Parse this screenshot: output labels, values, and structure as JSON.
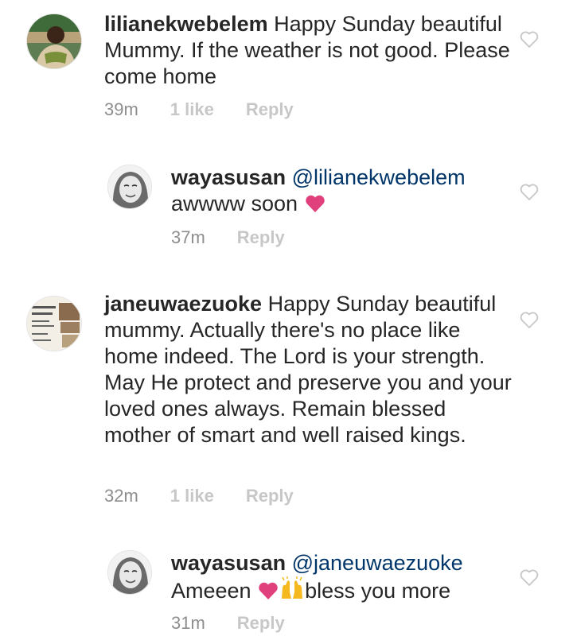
{
  "comments": [
    {
      "username": "lilianekwebelem",
      "text": "Happy Sunday beautiful Mummy. If the weather is not good. Please come home",
      "time": "39m",
      "likes": "1 like",
      "reply": "Reply"
    },
    {
      "username": "wayasusan",
      "mention": "@lilianekwebelem",
      "text": "awwww soon",
      "time": "37m",
      "reply": "Reply",
      "emoji": [
        "heart"
      ]
    },
    {
      "username": "janeuwaezuoke",
      "text": "Happy Sunday beautiful mummy. Actually there's no place like home indeed. The Lord is your strength. May He protect and preserve you and your loved ones always. Remain blessed mother of smart and well raised kings.",
      "time": "32m",
      "likes": "1 like",
      "reply": "Reply"
    },
    {
      "username": "wayasusan",
      "mention": "@janeuwaezuoke",
      "text_before": "Ameeen",
      "text_after": "bless you more",
      "time": "31m",
      "reply": "Reply",
      "emoji": [
        "heart",
        "raising-hands"
      ]
    }
  ],
  "colors": {
    "text": "#262626",
    "mention": "#003569",
    "muted": "#8e8e8e",
    "faint": "#c7c7c7",
    "emoji_heart": "#e0407b"
  }
}
